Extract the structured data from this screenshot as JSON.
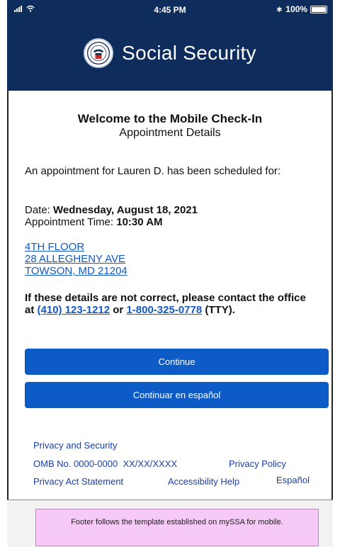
{
  "status_bar": {
    "time": "4:45 PM",
    "battery": "100%"
  },
  "header": {
    "brand": "Social Security"
  },
  "welcome": {
    "title": "Welcome to the Mobile Check-In",
    "subtitle": "Appointment Details"
  },
  "appointment": {
    "intro": "An appointment for Lauren D. has been scheduled for:",
    "date_label": "Date: ",
    "date_value": "Wednesday, August 18, 2021",
    "time_label": "Appointment Time: ",
    "time_value": "10:30 AM",
    "address": [
      "4TH FLOOR",
      "28 ALLEGHENY AVE",
      "TOWSON, MD 21204"
    ]
  },
  "contact": {
    "text_1": "If these details are not correct, please contact the office at ",
    "phone": "(410) 123-1212",
    "text_2": " or ",
    "tty_phone": "1-800-325-0778",
    "text_3": " (TTY)."
  },
  "buttons": {
    "continue": "Continue",
    "continue_spanish": "Continuar en español"
  },
  "footer_links": {
    "privacy_security": "Privacy and Security",
    "omb": "OMB No. 0000-0000  XX/XX/XXXX",
    "privacy_policy": "Privacy Policy",
    "privacy_act": "Privacy Act Statement",
    "accessibility": "Accessibility Help",
    "espanol": "Español"
  },
  "annotation": {
    "note": "Footer follows the template established on mySSA for mobile."
  },
  "colors": {
    "header_bg": "#0f2d5c",
    "button_bg": "#0d5bc7",
    "link": "#1259c3",
    "note_bg": "#f6c9f6"
  }
}
